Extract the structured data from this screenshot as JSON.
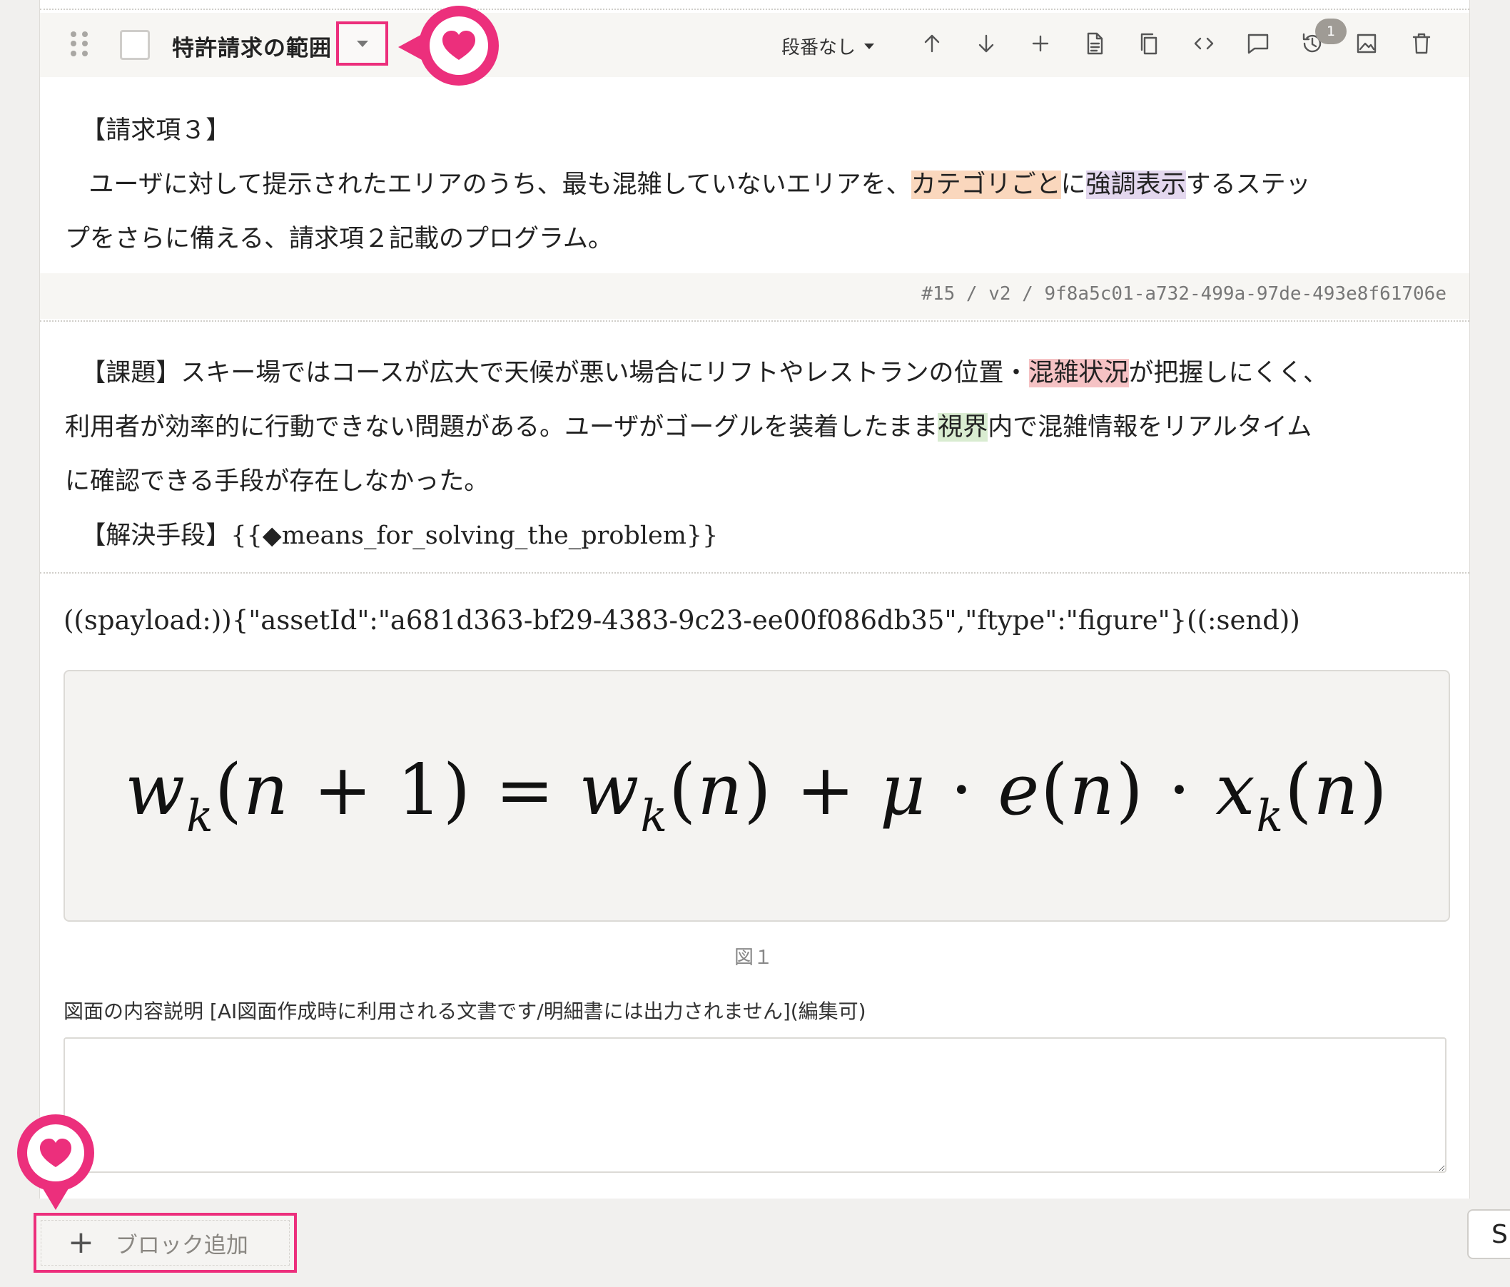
{
  "toolbar": {
    "block_title": "特許請求の範囲",
    "numbering_label": "段番なし",
    "history_badge": "1",
    "icons": [
      "drag-handle-icon",
      "checkbox",
      "chevron-down-icon",
      "arrow-up-icon",
      "arrow-down-icon",
      "plus-icon",
      "document-icon",
      "copy-icon",
      "code-icon",
      "comment-icon",
      "history-icon",
      "image-icon",
      "trash-icon"
    ]
  },
  "claim": {
    "heading": "【請求項３】",
    "line1_pre": "ユーザに対して提示されたエリアのうち、最も混雑していないエリアを、",
    "hl1": "カテゴリごと",
    "mid": "に",
    "hl2": "強調表示",
    "line1_post": "するステッ",
    "line2": "プをさらに備える、請求項２記載のプログラム。"
  },
  "meta": "#15 / v2 / 9f8a5c01-a732-499a-97de-493e8f61706e",
  "problem": {
    "l1_pre": "【課題】スキー場ではコースが広大で天候が悪い場合にリフトやレストランの位置・",
    "l1_hl": "混雑状況",
    "l1_post": "が把握しにくく、",
    "l2_pre": "利用者が効率的に行動できない問題がある。ユーザがゴーグルを装着したまま",
    "l2_hl": "視界",
    "l2_post": "内で混雑情報をリアルタイム",
    "l3": "に確認できる手段が存在しなかった。",
    "l4": "【解決手段】{{◆means_for_solving_the_problem}}"
  },
  "payload": "((spayload:)){\"assetId\":\"a681d363-bf29-4383-9c23-ee00f086db35\",\"ftype\":\"figure\"}((:send))",
  "figure": {
    "caption": "図１",
    "formula_display": "w_k(n+1) = w_k(n) + μ·e(n)·x_k(n)"
  },
  "description": {
    "label": "図面の内容説明 [AI図面作成時に利用される文書です/明細書には出力されません](編集可)",
    "value": ""
  },
  "add_block": {
    "label": "ブロック追加"
  },
  "side_button": {
    "label": "S"
  },
  "colors": {
    "accent_pink": "#ec2f7c",
    "hl_orange": "#fad7bd",
    "hl_purple": "#e3d7ee",
    "hl_red": "#f5c2c4",
    "hl_green": "#d9ecd1"
  }
}
